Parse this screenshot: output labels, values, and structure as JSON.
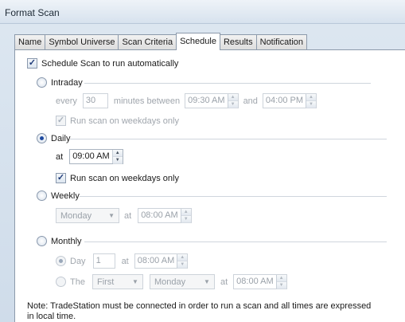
{
  "window": {
    "title": "Format Scan"
  },
  "tabs": [
    {
      "label": "Name"
    },
    {
      "label": "Symbol Universe"
    },
    {
      "label": "Scan Criteria"
    },
    {
      "label": "Schedule"
    },
    {
      "label": "Results"
    },
    {
      "label": "Notification"
    }
  ],
  "active_tab": "Schedule",
  "schedule": {
    "auto_label": "Schedule Scan to run automatically",
    "auto_checked": true,
    "intraday": {
      "label": "Intraday",
      "every_label": "every",
      "every_value": "30",
      "between_label": "minutes between",
      "start_time": "09:30 AM",
      "and_label": "and",
      "end_time": "04:00 PM",
      "weekdays_label": "Run scan on weekdays only"
    },
    "daily": {
      "label": "Daily",
      "at_label": "at",
      "time": "09:00 AM",
      "weekdays_label": "Run scan on weekdays only"
    },
    "weekly": {
      "label": "Weekly",
      "day": "Monday",
      "at_label": "at",
      "time": "08:00 AM"
    },
    "monthly": {
      "label": "Monthly",
      "day_label": "Day",
      "day_value": "1",
      "at_label": "at",
      "day_time": "08:00 AM",
      "the_label": "The",
      "ordinal": "First",
      "weekday": "Monday",
      "the_time": "08:00 AM"
    },
    "note": "Note: TradeStation must be connected in order to run a scan and all times are expressed in local time."
  }
}
